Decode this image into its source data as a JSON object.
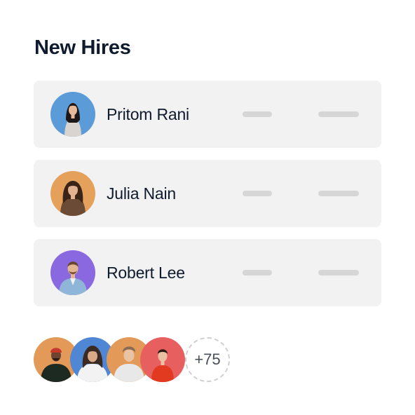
{
  "title": "New Hires",
  "hires": [
    {
      "name": "Pritom Rani",
      "avatar_bg": "#5b9bd8"
    },
    {
      "name": "Julia Nain",
      "avatar_bg": "#e5a15c"
    },
    {
      "name": "Robert Lee",
      "avatar_bg": "#8a68e0"
    }
  ],
  "team_avatars": [
    {
      "avatar_bg": "#e39a58"
    },
    {
      "avatar_bg": "#4f87d4"
    },
    {
      "avatar_bg": "#e39a58"
    },
    {
      "avatar_bg": "#e85f5f"
    }
  ],
  "more_count": "+75"
}
